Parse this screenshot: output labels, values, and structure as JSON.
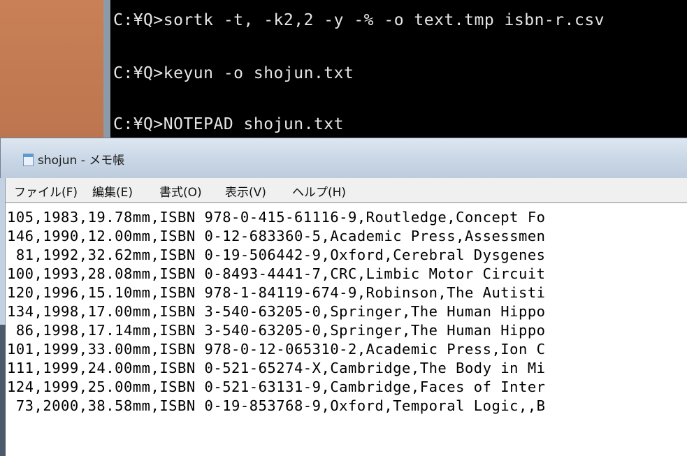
{
  "console": {
    "lines": [
      "C:¥Q>sortk -t, -k2,2 -y -% -o text.tmp isbn-r.csv",
      "C:¥Q>keyun -o shojun.txt",
      "C:¥Q>NOTEPAD shojun.txt"
    ]
  },
  "notepad": {
    "title": "shojun - メモ帳",
    "icon": "notepad-icon",
    "menu": [
      "ファイル(F)",
      "編集(E)",
      "書式(O)",
      "表示(V)",
      "ヘルプ(H)"
    ],
    "lines": [
      "105,1983,19.78mm,ISBN 978-0-415-61116-9,Routledge,Concept Fo",
      "146,1990,12.00mm,ISBN 0-12-683360-5,Academic Press,Assessmen",
      " 81,1992,32.62mm,ISBN 0-19-506442-9,Oxford,Cerebral Dysgenes",
      "100,1993,28.08mm,ISBN 0-8493-4441-7,CRC,Limbic Motor Circuit",
      "120,1996,15.10mm,ISBN 978-1-84119-674-9,Robinson,The Autisti",
      "134,1998,17.00mm,ISBN 3-540-63205-0,Springer,The Human Hippo",
      " 86,1998,17.14mm,ISBN 3-540-63205-0,Springer,The Human Hippo",
      "101,1999,33.00mm,ISBN 978-0-12-065310-2,Academic Press,Ion C",
      "111,1999,24.00mm,ISBN 0-521-65274-X,Cambridge,The Body in Mi",
      "124,1999,25.00mm,ISBN 0-521-63131-9,Cambridge,Faces of Inter",
      " 73,2000,38.58mm,ISBN 0-19-853768-9,Oxford,Temporal Logic,,B"
    ]
  }
}
